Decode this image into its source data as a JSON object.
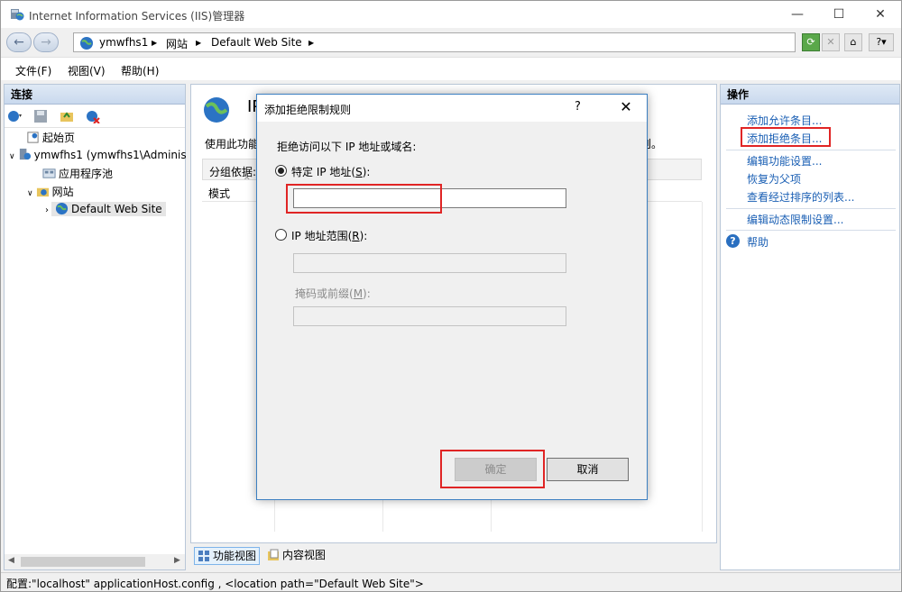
{
  "window": {
    "title": "Internet Information Services (IIS)管理器",
    "controls": {
      "minimize": "—",
      "maximize": "☐",
      "close": "✕"
    }
  },
  "address_bar": {
    "back": "←",
    "forward": "→",
    "breadcrumbs": [
      "ymwfhs1",
      "网站",
      "Default Web Site"
    ],
    "separator": "▶"
  },
  "menu": {
    "file": "文件(F)",
    "view": "视图(V)",
    "help": "帮助(H)"
  },
  "connections": {
    "header": "连接",
    "tree": {
      "start_page": "起始页",
      "server": "ymwfhs1 (ymwfhs1\\Adminis",
      "app_pools": "应用程序池",
      "sites": "网站",
      "default_site": "Default Web Site"
    }
  },
  "center": {
    "title": "IP",
    "description": "使用此功能",
    "description_end": "则。",
    "group_by_label": "分组依据:",
    "column_mode": "模式",
    "tabs": {
      "features": "功能视图",
      "content": "内容视图"
    }
  },
  "actions": {
    "header": "操作",
    "links": {
      "add_allow": "添加允许条目...",
      "add_deny": "添加拒绝条目...",
      "edit_feature": "编辑功能设置...",
      "revert": "恢复为父项",
      "view_ordered": "查看经过排序的列表...",
      "edit_dynamic": "编辑动态限制设置...",
      "help": "帮助"
    }
  },
  "dialog": {
    "title": "添加拒绝限制规则",
    "help_glyph": "?",
    "close_glyph": "✕",
    "instruction": "拒绝访问以下 IP 地址或域名:",
    "specific_ip_label": "特定 IP 地址(",
    "specific_ip_key": "S",
    "specific_ip_suffix": "):",
    "specific_ip_value": "",
    "range_label": "IP 地址范围(",
    "range_key": "R",
    "range_suffix": "):",
    "range_value": "",
    "mask_label": "掩码或前缀(",
    "mask_key": "M",
    "mask_suffix": "):",
    "mask_value": "",
    "ok_button": "确定",
    "cancel_button": "取消",
    "selected_option": "specific_ip"
  },
  "status_bar": {
    "text": "配置:\"localhost\" applicationHost.config , <location path=\"Default Web Site\">"
  },
  "colors": {
    "highlight_box": "#e02525",
    "link": "#1a5fb4",
    "dialog_border": "#3c7fc1"
  }
}
